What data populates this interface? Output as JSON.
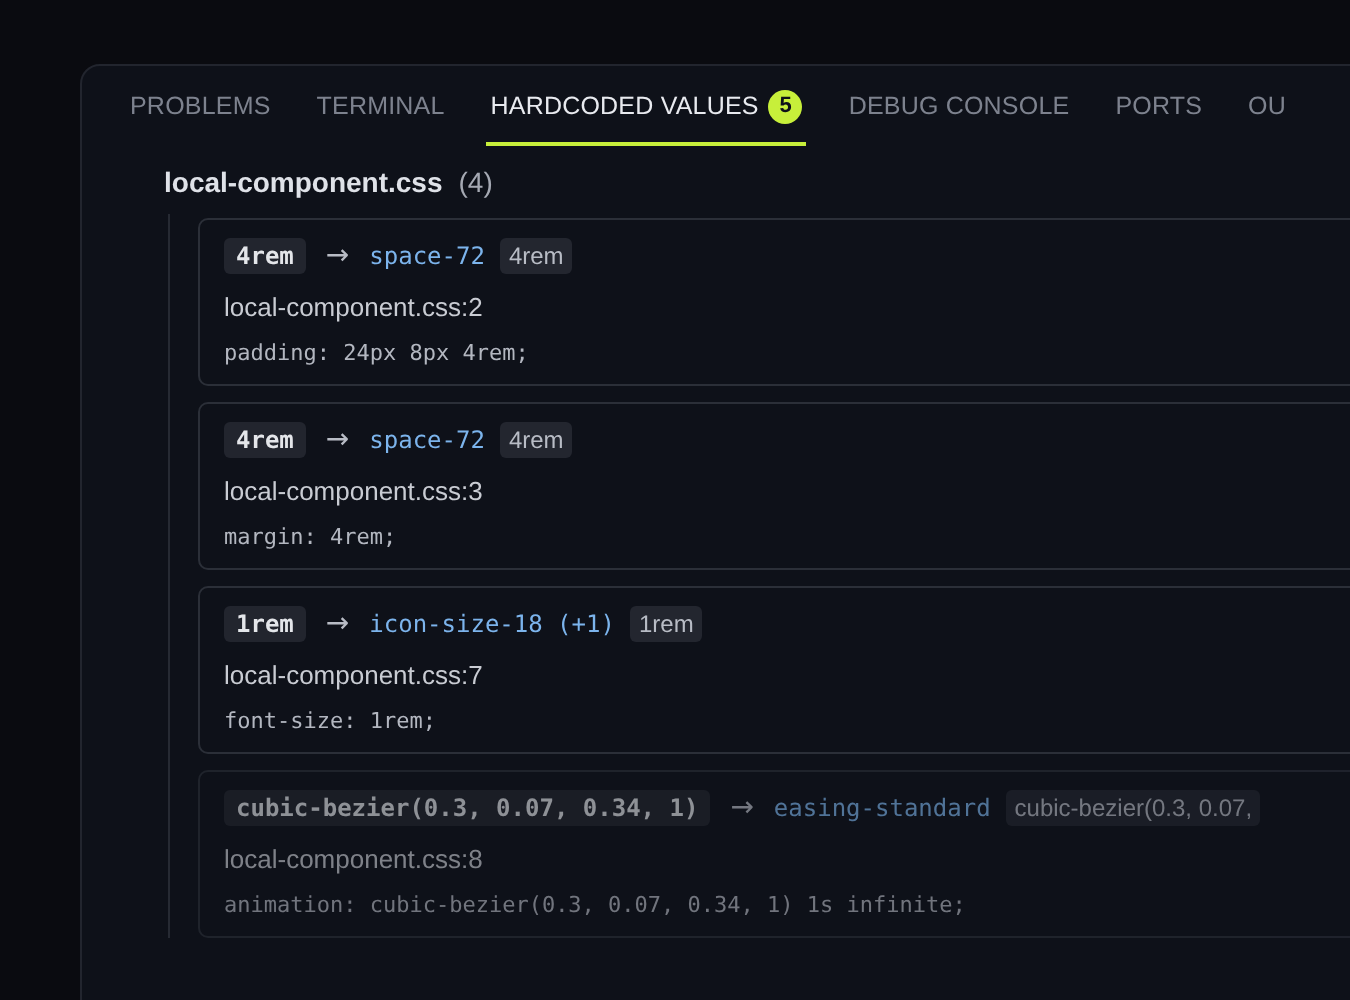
{
  "tabs": [
    {
      "label": "PROBLEMS",
      "selected": false
    },
    {
      "label": "TERMINAL",
      "selected": false
    },
    {
      "label": "HARDCODED VALUES",
      "selected": true,
      "badge": "5"
    },
    {
      "label": "DEBUG CONSOLE",
      "selected": false
    },
    {
      "label": "PORTS",
      "selected": false
    },
    {
      "label": "OU",
      "selected": false
    }
  ],
  "group": {
    "file": "local-component.css",
    "count": "(4)"
  },
  "items": [
    {
      "value": "4rem",
      "arrow": "→",
      "token": "space-72",
      "token_value": "4rem",
      "location": "local-component.css:2",
      "code": "padding: 24px 8px 4rem;",
      "dimmed": false
    },
    {
      "value": "4rem",
      "arrow": "→",
      "token": "space-72",
      "token_value": "4rem",
      "location": "local-component.css:3",
      "code": "margin: 4rem;",
      "dimmed": false
    },
    {
      "value": "1rem",
      "arrow": "→",
      "token": "icon-size-18 (+1)",
      "token_value": "1rem",
      "location": "local-component.css:7",
      "code": "font-size: 1rem;",
      "dimmed": false
    },
    {
      "value": "cubic-bezier(0.3, 0.07, 0.34, 1)",
      "arrow": "→",
      "token": "easing-standard",
      "token_value": "cubic-bezier(0.3, 0.07,",
      "location": "local-component.css:8",
      "code": "animation: cubic-bezier(0.3, 0.07, 0.34, 1) 1s infinite;",
      "dimmed": true
    }
  ]
}
